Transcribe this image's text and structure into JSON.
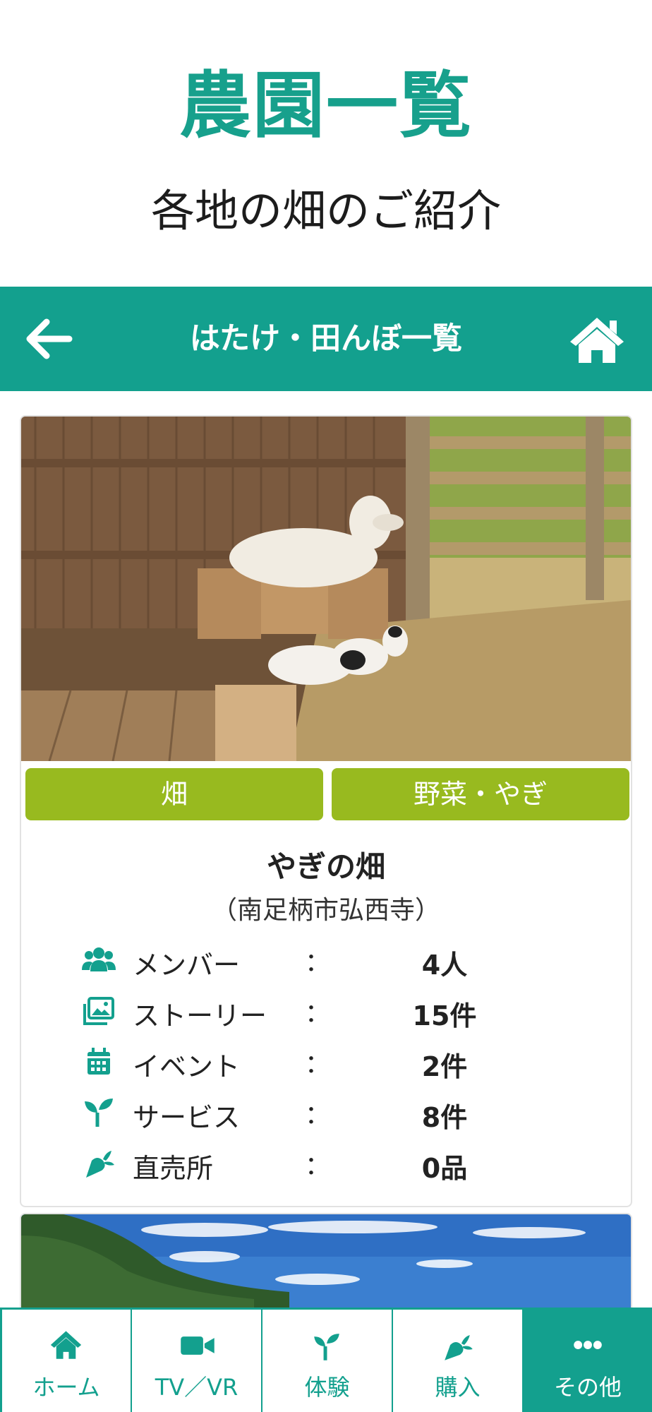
{
  "hero": {
    "title": "農園一覧",
    "subtitle": "各地の畑のご紹介"
  },
  "appbar": {
    "title": "はたけ・田んぼ一覧",
    "back_icon": "arrow-left-icon",
    "home_icon": "home-icon"
  },
  "farm": {
    "tags": [
      "畑",
      "野菜・やぎ"
    ],
    "name": "やぎの畑",
    "location": "（南足柄市弘西寺）",
    "stats": [
      {
        "icon": "members-icon",
        "label": "メンバー",
        "sep": "：",
        "value": "4人"
      },
      {
        "icon": "story-icon",
        "label": "ストーリー",
        "sep": "：",
        "value": "15件"
      },
      {
        "icon": "calendar-icon",
        "label": "イベント",
        "sep": "：",
        "value": "2件"
      },
      {
        "icon": "sprout-icon",
        "label": "サービス",
        "sep": "：",
        "value": "8件"
      },
      {
        "icon": "carrot-icon",
        "label": "直売所",
        "sep": "：",
        "value": "0品"
      }
    ]
  },
  "nav": {
    "items": [
      {
        "icon": "home-icon",
        "label": "ホーム",
        "active": false
      },
      {
        "icon": "video-icon",
        "label": "TV／VR",
        "active": false
      },
      {
        "icon": "sprout-icon",
        "label": "体験",
        "active": false
      },
      {
        "icon": "carrot-icon",
        "label": "購入",
        "active": false
      },
      {
        "icon": "more-icon",
        "label": "その他",
        "active": true
      }
    ]
  },
  "colors": {
    "brand": "#13a08e",
    "tag": "#98ba1f"
  }
}
